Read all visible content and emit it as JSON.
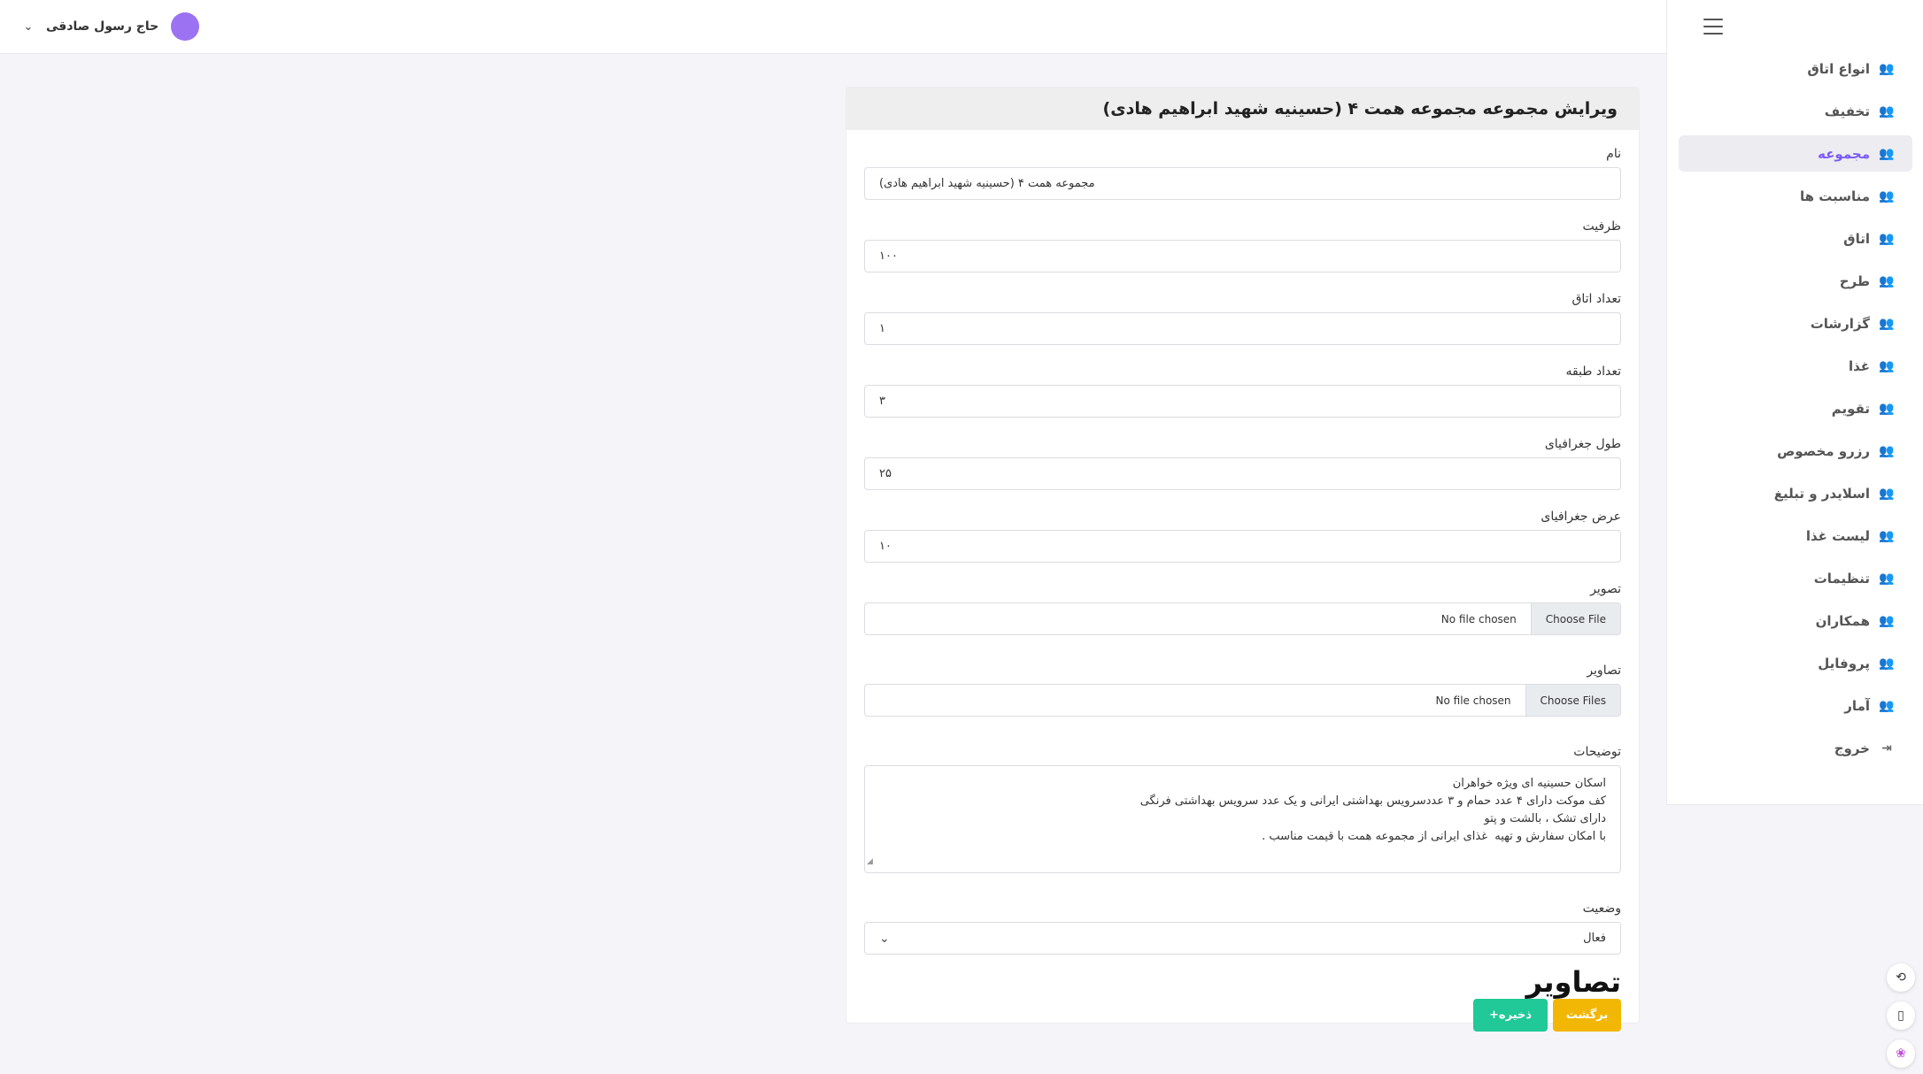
{
  "topbar": {
    "user_name": "حاج رسول صادقی",
    "user_chevron": "⌄",
    "avatar_color": "#9b72f2"
  },
  "sidebar": {
    "menu_icon": "hamburger-menu-icon",
    "items": [
      {
        "label": "انواع اتاق",
        "icon": "users-icon",
        "active": false
      },
      {
        "label": "تخفیف",
        "icon": "users-icon",
        "active": false
      },
      {
        "label": "مجموعه",
        "icon": "users-icon",
        "active": true
      },
      {
        "label": "مناسبت ها",
        "icon": "users-icon",
        "active": false
      },
      {
        "label": "اتاق",
        "icon": "users-icon",
        "active": false
      },
      {
        "label": "طرح",
        "icon": "users-icon",
        "active": false
      },
      {
        "label": "گزارشات",
        "icon": "users-icon",
        "active": false
      },
      {
        "label": "غذا",
        "icon": "users-icon",
        "active": false
      },
      {
        "label": "تقویم",
        "icon": "users-icon",
        "active": false
      },
      {
        "label": "رزرو مخصوص",
        "icon": "users-icon",
        "active": false
      },
      {
        "label": "اسلایدر و تبلیغ",
        "icon": "users-icon",
        "active": false
      },
      {
        "label": "لیست غذا",
        "icon": "users-icon",
        "active": false
      },
      {
        "label": "تنظیمات",
        "icon": "users-icon",
        "active": false
      },
      {
        "label": "همکاران",
        "icon": "users-icon",
        "active": false
      },
      {
        "label": "پروفایل",
        "icon": "users-icon",
        "active": false
      },
      {
        "label": "آمار",
        "icon": "users-icon",
        "active": false
      },
      {
        "label": "خروج",
        "icon": "logout-icon",
        "active": false
      }
    ],
    "active_color": "#7a5af8"
  },
  "form": {
    "title": "ویرایش مجموعه مجموعه همت ۴ (حسینیه شهید ابراهیم هادی)",
    "name_label": "نام",
    "name_value": "مجموعه همت ۴ (حسینیه شهید ابراهیم هادی)",
    "capacity_label": "ظرفیت",
    "capacity_value": "۱۰۰",
    "rooms_label": "تعداد اتاق",
    "rooms_value": "۱",
    "floors_label": "تعداد طبقه",
    "floors_value": "۳",
    "longitude_label": "طول جغرافیای",
    "longitude_value": "۲۵",
    "latitude_label": "عرض جغرافیای",
    "latitude_value": "۱۰",
    "image_label": "تصویر",
    "image_button": "Choose File",
    "image_status": "No file chosen",
    "images_label": "تصاویر",
    "images_button": "Choose Files",
    "images_status": "No file chosen",
    "description_label": "توضیحات",
    "description_lines": [
      "اسکان حسینیه ای ویژه خواهران",
      "کف موکت دارای ۴ عدد حمام و ۳ عددسرویس بهداشتی ایرانی و یک عدد سرویس بهداشتی فرنگی",
      "دارای تشک ، بالشت و پتو",
      "با امکان سفارش و تهیه  غذای ایرانی از مجموعه همت با قیمت مناسب ."
    ],
    "status_label": "وضعیت",
    "status_value": "فعال",
    "images_heading": "تصاویر",
    "back_button": "برگشت",
    "save_button": "ذخیره+",
    "back_color": "#f2b705",
    "save_color": "#20c997"
  },
  "floating": {
    "items": [
      "translate-icon",
      "book-icon",
      "brain-icon"
    ]
  }
}
